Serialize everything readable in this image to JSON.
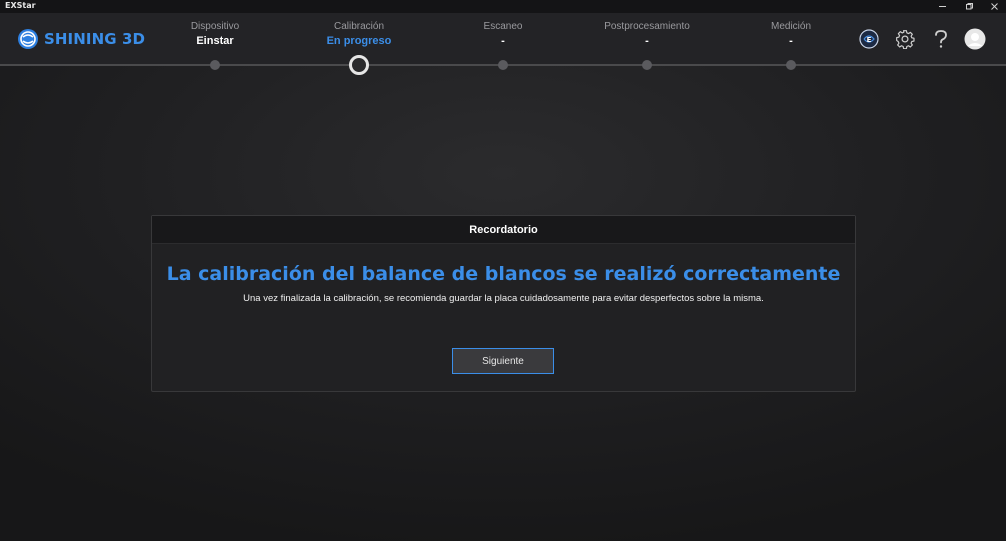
{
  "window": {
    "title": "EXStar",
    "controls": [
      "minimize-icon",
      "restore-icon",
      "close-icon"
    ]
  },
  "brand": {
    "name": "SHINING 3D",
    "color": "#3b8ee8"
  },
  "steps": [
    {
      "label": "Dispositivo",
      "status": "Einstar",
      "active": false
    },
    {
      "label": "Calibración",
      "status": "En progreso",
      "active": true
    },
    {
      "label": "Escaneo",
      "status": "-",
      "active": false
    },
    {
      "label": "Postprocesamiento",
      "status": "-",
      "active": false
    },
    {
      "label": "Medición",
      "status": "-",
      "active": false
    }
  ],
  "header_icons": [
    "exstar-logo-icon",
    "gear-icon",
    "help-icon",
    "user-avatar-icon"
  ],
  "dialog": {
    "header": "Recordatorio",
    "title": "La calibración del balance de blancos se realizó correctamente",
    "message": "Una vez finalizada la calibración, se recomienda guardar la placa cuidadosamente para evitar desperfectos sobre la misma.",
    "button_label": "Siguiente"
  }
}
